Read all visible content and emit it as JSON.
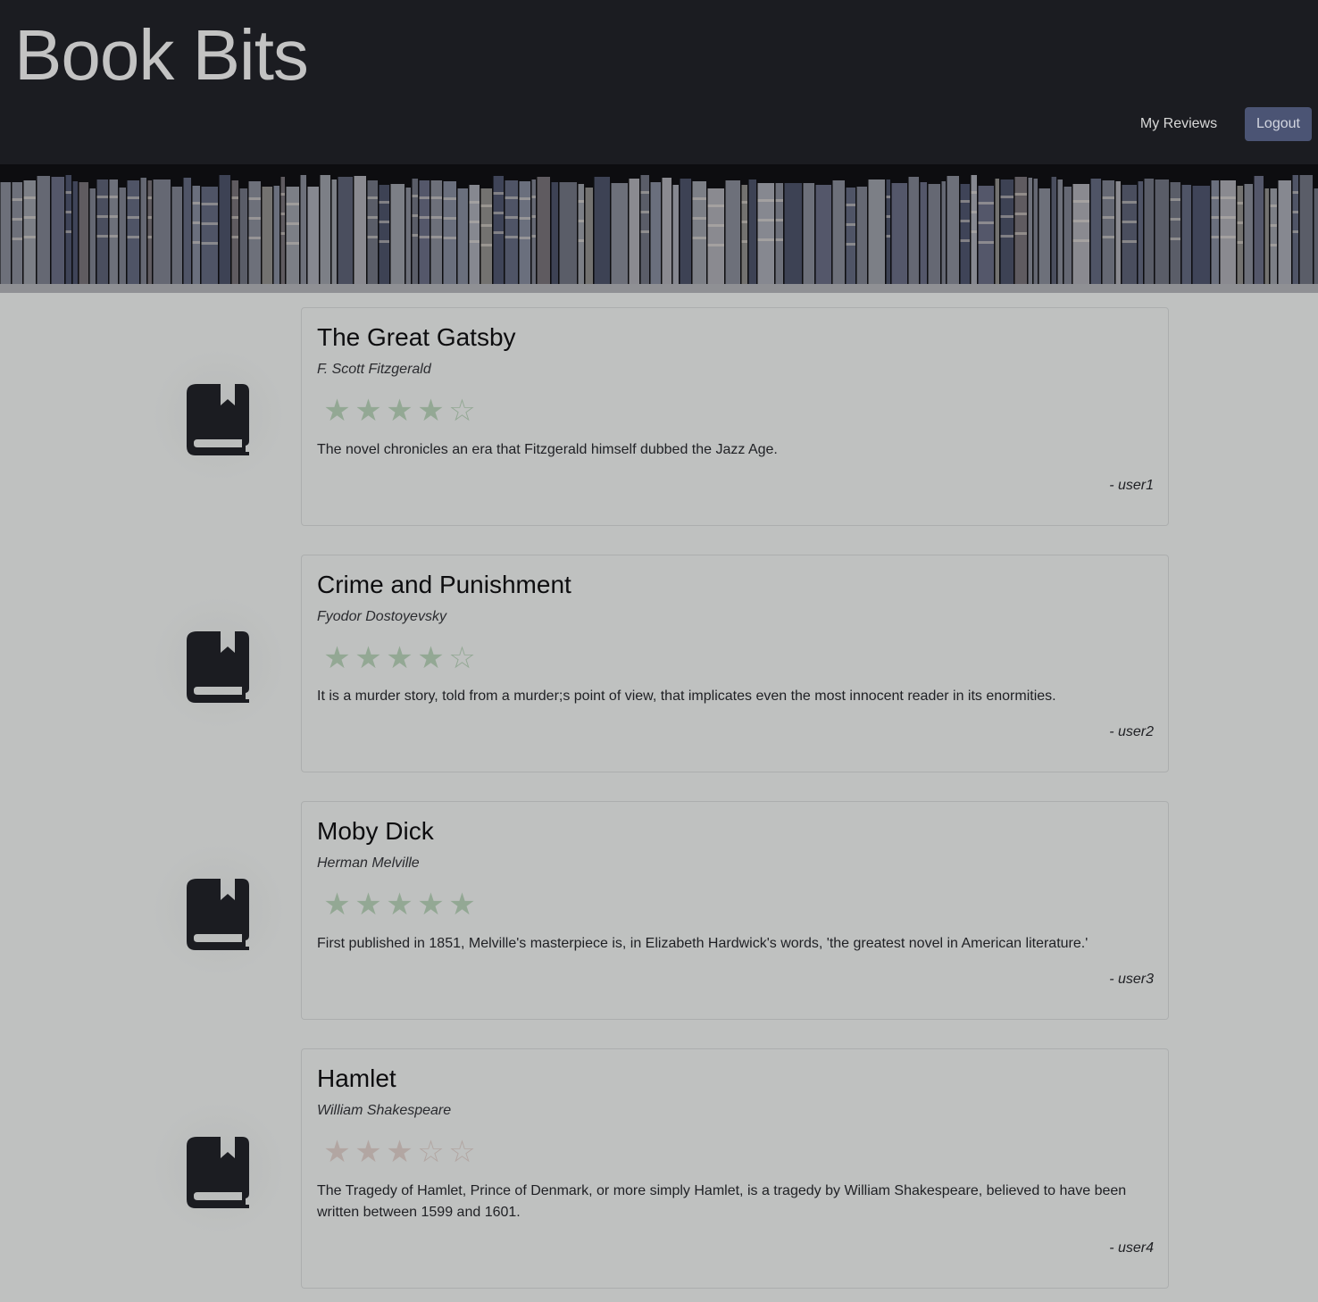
{
  "header": {
    "brand": "Book Bits",
    "nav_my_reviews": "My Reviews",
    "logout_label": "Logout"
  },
  "colors": {
    "header_bg": "#1b1c21",
    "page_bg": "#bfc1c0",
    "logout_bg": "#4b5474",
    "star_green": "#93a894",
    "star_tan": "#b2a6a2"
  },
  "reviews": [
    {
      "title": "The Great Gatsby",
      "author": "F. Scott Fitzgerald",
      "rating": 4,
      "max_rating": 5,
      "text": "The novel chronicles an era that Fitzgerald himself dubbed the Jazz Age.",
      "user": "- user1",
      "icon": "book-icon"
    },
    {
      "title": "Crime and Punishment",
      "author": "Fyodor Dostoyevsky",
      "rating": 4,
      "max_rating": 5,
      "text": "It is a murder story, told from a murder;s point of view, that implicates even the most innocent reader in its enormities.",
      "user": "- user2",
      "icon": "book-icon"
    },
    {
      "title": "Moby Dick",
      "author": "Herman Melville",
      "rating": 5,
      "max_rating": 5,
      "text": "First published in 1851, Melville's masterpiece is, in Elizabeth Hardwick's words, 'the greatest novel in American literature.'",
      "user": "- user3",
      "icon": "book-icon"
    },
    {
      "title": "Hamlet",
      "author": "William Shakespeare",
      "rating": 3,
      "max_rating": 5,
      "text": "The Tragedy of Hamlet, Prince of Denmark, or more simply Hamlet, is a tragedy by William Shakespeare, believed to have been written between 1599 and 1601.",
      "user": "- user4",
      "icon": "book-icon"
    }
  ]
}
